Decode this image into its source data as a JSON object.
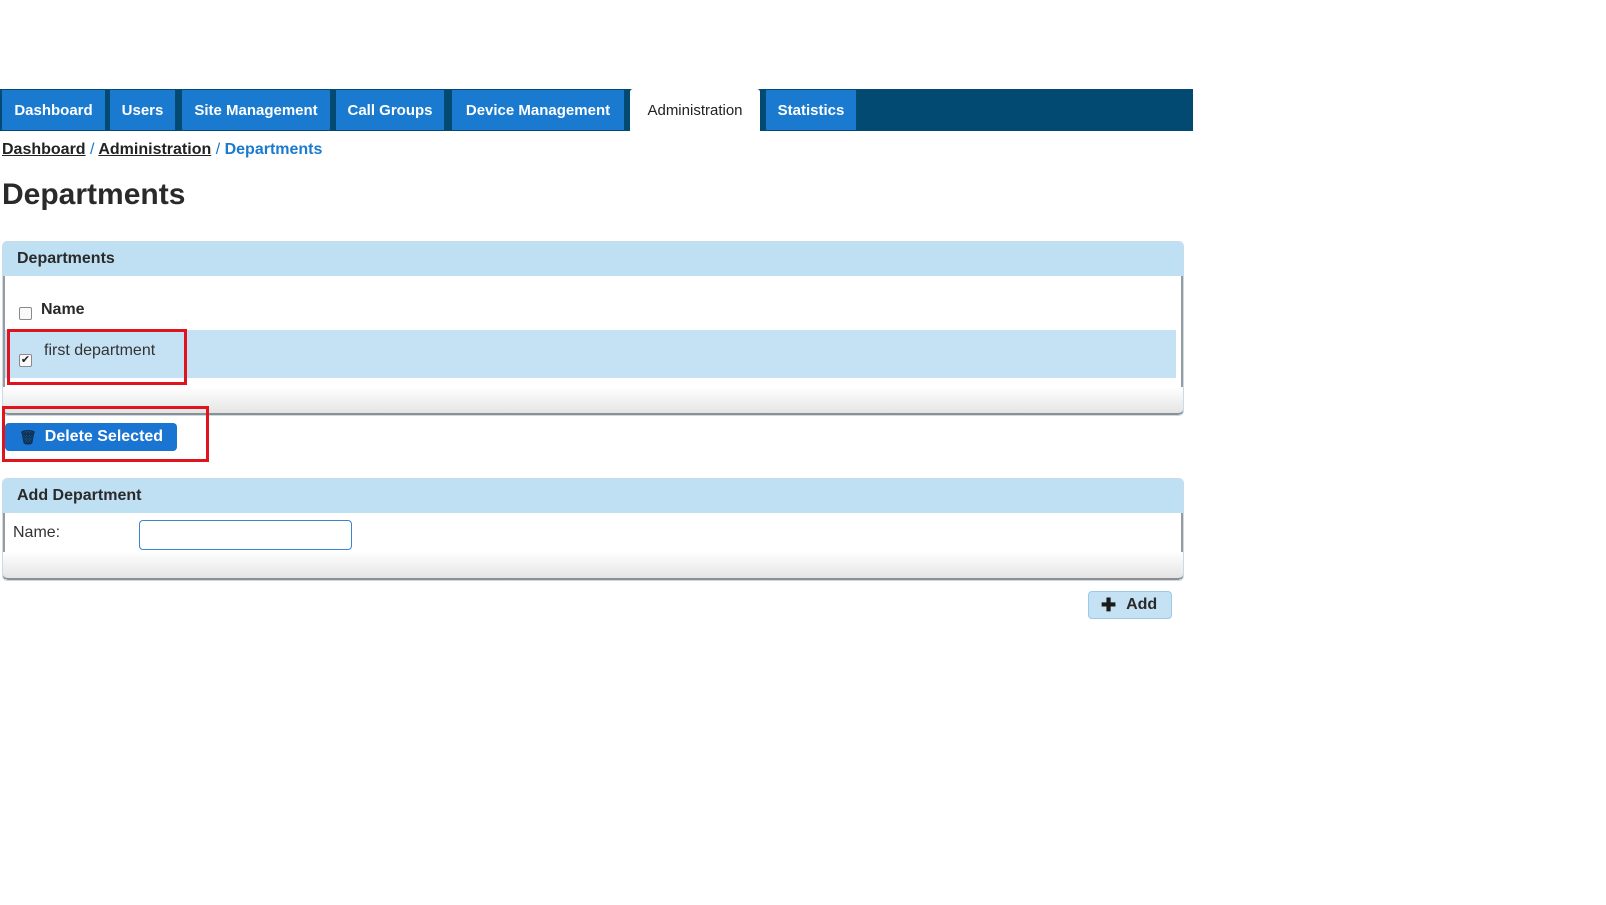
{
  "nav": {
    "tabs": [
      {
        "label": "Dashboard",
        "active": false
      },
      {
        "label": "Users",
        "active": false
      },
      {
        "label": "Site Management",
        "active": false
      },
      {
        "label": "Call Groups",
        "active": false
      },
      {
        "label": "Device Management",
        "active": false
      },
      {
        "label": "Administration",
        "active": true
      },
      {
        "label": "Statistics",
        "active": false
      }
    ]
  },
  "breadcrumb": {
    "items": [
      "Dashboard",
      "Administration"
    ],
    "separator": "/",
    "current": "Departments"
  },
  "page": {
    "title": "Departments"
  },
  "departments_panel": {
    "title": "Departments",
    "column_header": "Name",
    "select_all_checked": false,
    "rows": [
      {
        "name": "first department",
        "checked": true
      }
    ]
  },
  "actions": {
    "delete_label": "Delete Selected",
    "add_label": "Add"
  },
  "add_panel": {
    "title": "Add Department",
    "name_label": "Name:",
    "name_value": ""
  },
  "colors": {
    "nav_bg": "#024a71",
    "tab_bg": "#1a7ad0",
    "panel_header_bg": "#bfe0f2",
    "selected_row_bg": "#c4e2f3",
    "highlight": "#e0141e"
  },
  "icons": {
    "delete": "trash-icon",
    "add": "plus-icon"
  }
}
